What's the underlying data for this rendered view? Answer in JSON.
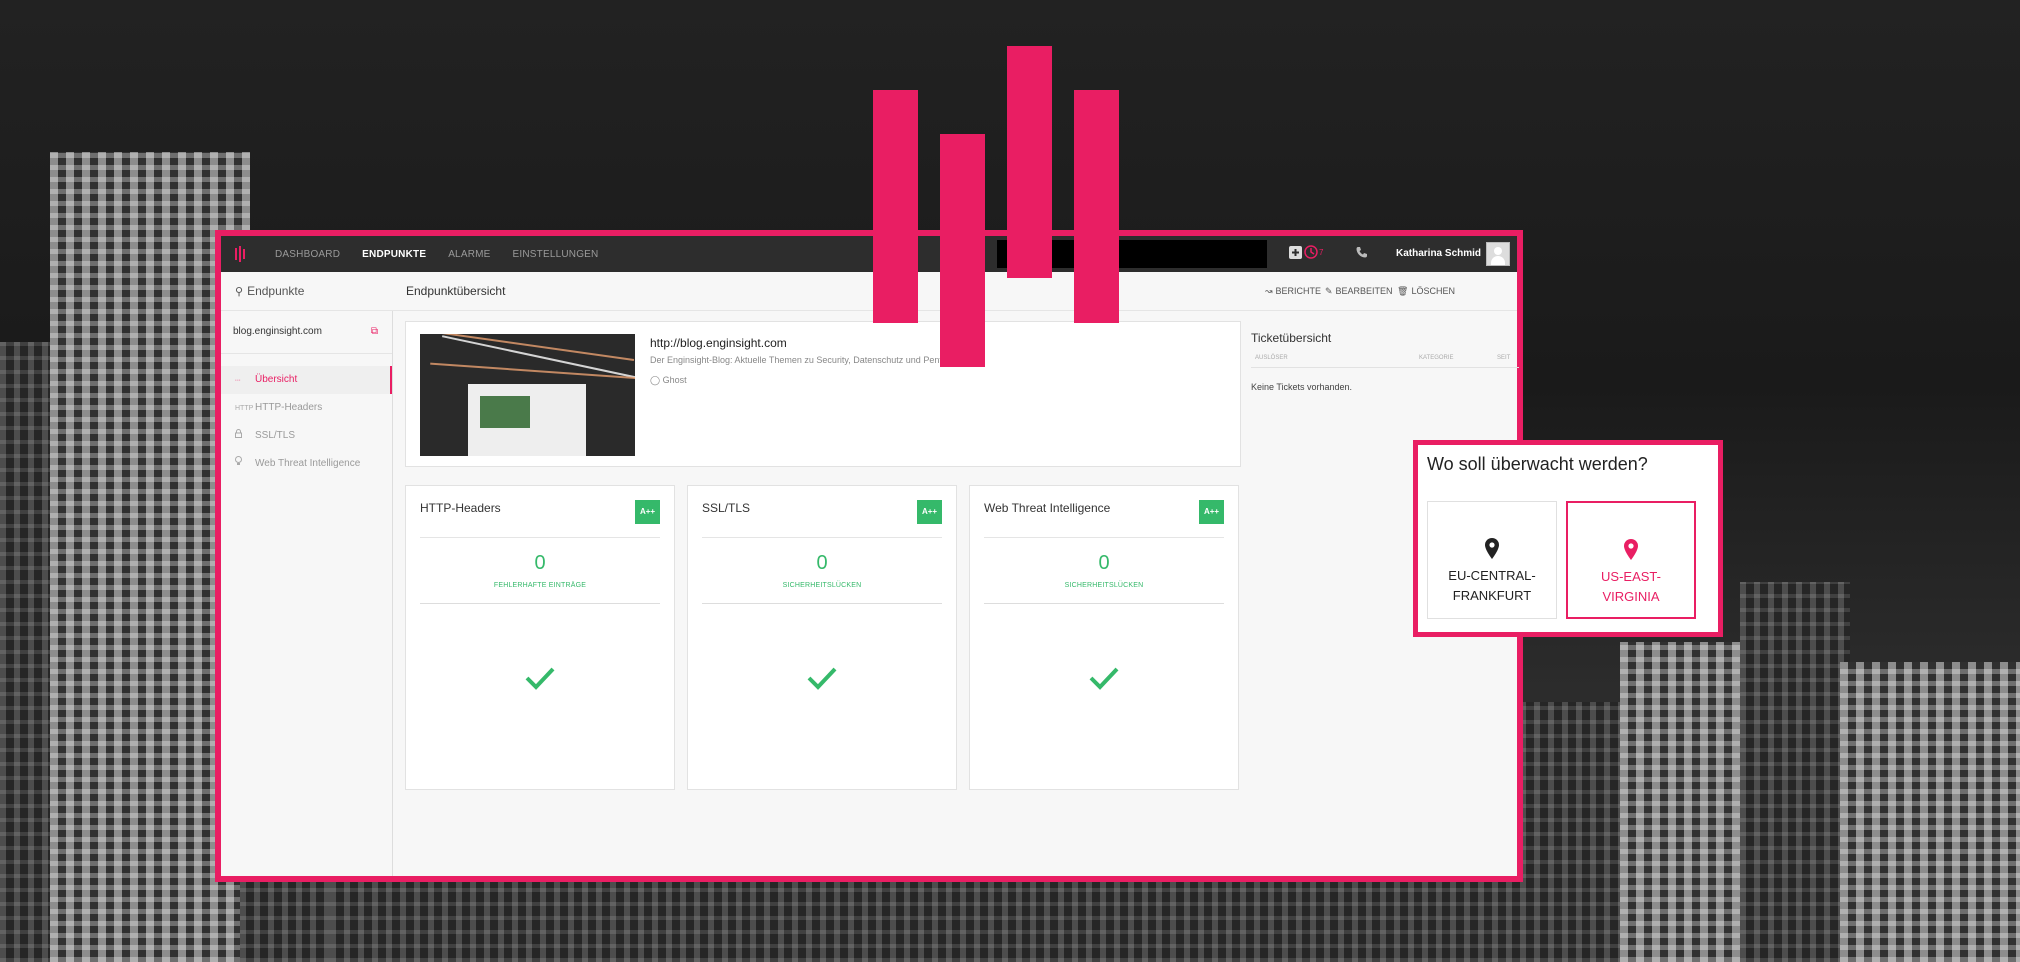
{
  "colors": {
    "accent": "#e91e63",
    "success": "#35b96a",
    "topbar": "#2d2d2d"
  },
  "nav": {
    "items": [
      {
        "label": "DASHBOARD",
        "active": false
      },
      {
        "label": "ENDPUNKTE",
        "active": true
      },
      {
        "label": "ALARME",
        "active": false
      },
      {
        "label": "EINSTELLUNGEN",
        "active": false
      }
    ],
    "alarm_count": "7",
    "user_name": "Katharina Schmid"
  },
  "sidebar": {
    "heading": "Endpunkte",
    "site": "blog.enginsight.com",
    "items": [
      {
        "label": "Übersicht",
        "icon": "pulse-icon",
        "active": true
      },
      {
        "label": "HTTP-Headers",
        "icon": "http-icon",
        "active": false
      },
      {
        "label": "SSL/TLS",
        "icon": "lock-icon",
        "active": false
      },
      {
        "label": "Web Threat Intelligence",
        "icon": "bulb-icon",
        "active": false
      }
    ]
  },
  "main": {
    "title": "Endpunktübersicht",
    "actions": {
      "reports": "BERICHTE",
      "edit": "BEARBEITEN",
      "delete": "LÖSCHEN"
    }
  },
  "site": {
    "url": "http://blog.enginsight.com",
    "description": "Der Enginsight-Blog: Aktuelle Themen zu Security, Datenschutz und Pentesting",
    "cms": "Ghost"
  },
  "tickets": {
    "title": "Ticketübersicht",
    "columns": [
      "AUSLÖSER",
      "KATEGORIE",
      "SEIT"
    ],
    "empty": "Keine Tickets vorhanden."
  },
  "modules": [
    {
      "title": "HTTP-Headers",
      "grade": "A++",
      "count": "0",
      "label": "FEHLERHAFTE EINTRÄGE"
    },
    {
      "title": "SSL/TLS",
      "grade": "A++",
      "count": "0",
      "label": "SICHERHEITSLÜCKEN"
    },
    {
      "title": "Web Threat Intelligence",
      "grade": "A++",
      "count": "0",
      "label": "SICHERHEITSLÜCKEN"
    }
  ],
  "popup": {
    "title": "Wo soll überwacht werden?",
    "locations": [
      {
        "name": "EU-CENTRAL-FRANKFURT",
        "selected": false
      },
      {
        "name": "US-EAST-VIRGINIA",
        "selected": true
      }
    ]
  }
}
